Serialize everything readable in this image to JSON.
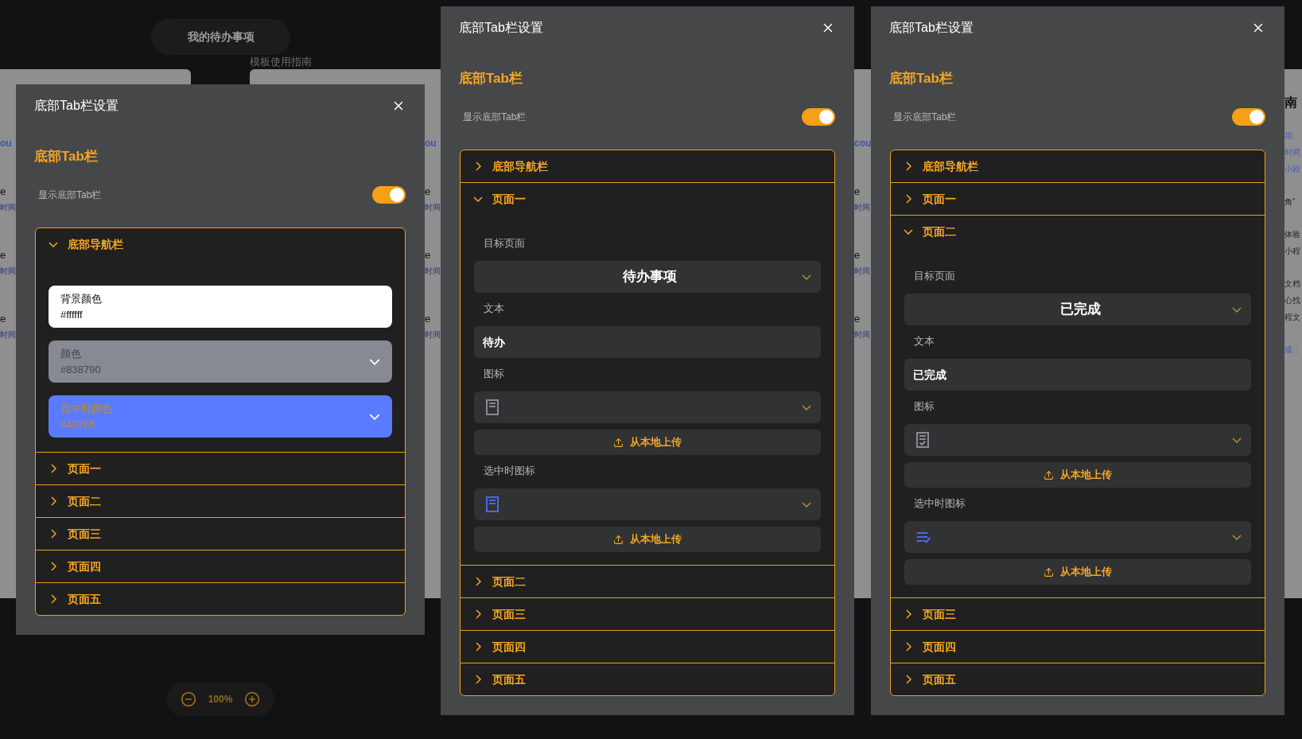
{
  "background": {
    "header_title": "我的待办事项",
    "guide_link": "模板使用指南",
    "zoom_text": "100%",
    "strips": [
      {
        "groups": [
          {
            "kind": "title",
            "lines": [
              "ou"
            ]
          },
          {
            "kind": "item",
            "lines": [
              "e",
              "时间"
            ]
          },
          {
            "kind": "item",
            "lines": [
              "e",
              "时间"
            ]
          },
          {
            "kind": "item",
            "lines": [
              "e",
              "时间"
            ]
          }
        ]
      },
      {
        "groups": [
          {
            "kind": "title",
            "lines": [
              "ou"
            ]
          },
          {
            "kind": "item",
            "lines": [
              "e",
              "时间"
            ]
          },
          {
            "kind": "item",
            "lines": [
              "e",
              "时间"
            ]
          },
          {
            "kind": "item",
            "lines": [
              "e",
              "时间"
            ]
          }
        ]
      },
      {
        "groups": [
          {
            "kind": "title",
            "lines": [
              "cou"
            ]
          },
          {
            "kind": "item",
            "lines": [
              "e",
              "时间"
            ]
          },
          {
            "kind": "item",
            "lines": [
              "e",
              "时间"
            ]
          },
          {
            "kind": "item",
            "lines": [
              "e",
              "时间"
            ]
          }
        ]
      },
      {
        "groups": [
          {
            "kind": "heading",
            "lines": [
              "南"
            ]
          },
          {
            "kind": "link",
            "lines": [
              "用。",
              "时间",
              "小程"
            ]
          },
          {
            "kind": "body",
            "lines": [
              "角“"
            ]
          },
          {
            "kind": "body",
            "lines": [
              "体验",
              "小程"
            ]
          },
          {
            "kind": "body",
            "lines": [
              "文档",
              "心找",
              "程文"
            ]
          },
          {
            "kind": "link",
            "lines": [
              "成："
            ]
          }
        ]
      }
    ]
  },
  "panels": [
    {
      "title": "底部Tab栏设置",
      "section_title": "底部Tab栏",
      "toggle": {
        "label": "显示底部Tab栏",
        "on": true
      },
      "sections": [
        {
          "title": "底部导航栏",
          "expanded": true,
          "kind": "colors",
          "fields": [
            {
              "label": "背景颜色",
              "value": "#ffffff",
              "color": "#ffffff",
              "kind": "light",
              "dropdown": false
            },
            {
              "label": "颜色",
              "value": "#838790",
              "color": "#878a92",
              "kind": "muted",
              "dropdown": true
            },
            {
              "label": "选中时颜色",
              "value": "#4076ff",
              "color": "#5a7bff",
              "kind": "accent",
              "dropdown": true
            }
          ]
        },
        {
          "title": "页面一",
          "expanded": false
        },
        {
          "title": "页面二",
          "expanded": false
        },
        {
          "title": "页面三",
          "expanded": false
        },
        {
          "title": "页面四",
          "expanded": false
        },
        {
          "title": "页面五",
          "expanded": false
        }
      ]
    },
    {
      "title": "底部Tab栏设置",
      "section_title": "底部Tab栏",
      "toggle": {
        "label": "显示底部Tab栏",
        "on": true
      },
      "sections": [
        {
          "title": "底部导航栏",
          "expanded": false
        },
        {
          "title": "页面一",
          "expanded": true,
          "kind": "page",
          "fields": [
            {
              "kind": "select",
              "label": "目标页面",
              "value": "待办事项"
            },
            {
              "kind": "text",
              "label": "文本",
              "value": "待办"
            },
            {
              "kind": "icon",
              "label": "图标",
              "icon": {
                "kind": "document",
                "color": "#8a8b8e"
              },
              "upload": "从本地上传"
            },
            {
              "kind": "icon",
              "label": "选中时图标",
              "icon": {
                "kind": "document",
                "color": "#4a68e8"
              },
              "upload": "从本地上传"
            }
          ]
        },
        {
          "title": "页面二",
          "expanded": false
        },
        {
          "title": "页面三",
          "expanded": false
        },
        {
          "title": "页面四",
          "expanded": false
        },
        {
          "title": "页面五",
          "expanded": false
        }
      ]
    },
    {
      "title": "底部Tab栏设置",
      "section_title": "底部Tab栏",
      "toggle": {
        "label": "显示底部Tab栏",
        "on": true
      },
      "sections": [
        {
          "title": "底部导航栏",
          "expanded": false
        },
        {
          "title": "页面一",
          "expanded": false
        },
        {
          "title": "页面二",
          "expanded": true,
          "kind": "page",
          "fields": [
            {
              "kind": "select",
              "label": "目标页面",
              "value": "已完成"
            },
            {
              "kind": "text",
              "label": "文本",
              "value": "已完成"
            },
            {
              "kind": "icon",
              "label": "图标",
              "icon": {
                "kind": "document-check",
                "color": "#8a8b8e"
              },
              "upload": "从本地上传"
            },
            {
              "kind": "icon",
              "label": "选中时图标",
              "icon": {
                "kind": "checklist",
                "color": "#4a68e8"
              },
              "upload": "从本地上传"
            }
          ]
        },
        {
          "title": "页面三",
          "expanded": false
        },
        {
          "title": "页面四",
          "expanded": false
        },
        {
          "title": "页面五",
          "expanded": false
        }
      ]
    }
  ]
}
